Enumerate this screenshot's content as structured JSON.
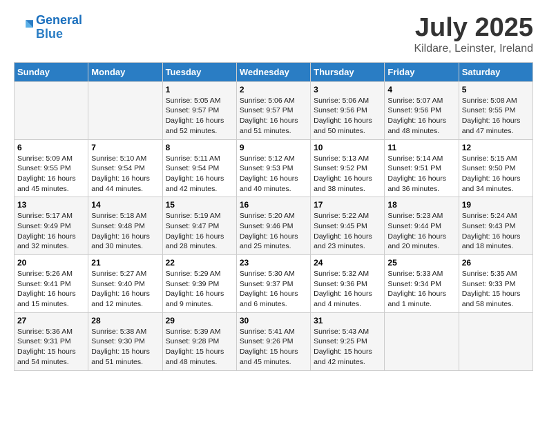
{
  "logo": {
    "line1": "General",
    "line2": "Blue"
  },
  "title": "July 2025",
  "subtitle": "Kildare, Leinster, Ireland",
  "days_of_week": [
    "Sunday",
    "Monday",
    "Tuesday",
    "Wednesday",
    "Thursday",
    "Friday",
    "Saturday"
  ],
  "weeks": [
    [
      {
        "day": "",
        "sunrise": "",
        "sunset": "",
        "daylight": ""
      },
      {
        "day": "",
        "sunrise": "",
        "sunset": "",
        "daylight": ""
      },
      {
        "day": "1",
        "sunrise": "Sunrise: 5:05 AM",
        "sunset": "Sunset: 9:57 PM",
        "daylight": "Daylight: 16 hours and 52 minutes."
      },
      {
        "day": "2",
        "sunrise": "Sunrise: 5:06 AM",
        "sunset": "Sunset: 9:57 PM",
        "daylight": "Daylight: 16 hours and 51 minutes."
      },
      {
        "day": "3",
        "sunrise": "Sunrise: 5:06 AM",
        "sunset": "Sunset: 9:56 PM",
        "daylight": "Daylight: 16 hours and 50 minutes."
      },
      {
        "day": "4",
        "sunrise": "Sunrise: 5:07 AM",
        "sunset": "Sunset: 9:56 PM",
        "daylight": "Daylight: 16 hours and 48 minutes."
      },
      {
        "day": "5",
        "sunrise": "Sunrise: 5:08 AM",
        "sunset": "Sunset: 9:55 PM",
        "daylight": "Daylight: 16 hours and 47 minutes."
      }
    ],
    [
      {
        "day": "6",
        "sunrise": "Sunrise: 5:09 AM",
        "sunset": "Sunset: 9:55 PM",
        "daylight": "Daylight: 16 hours and 45 minutes."
      },
      {
        "day": "7",
        "sunrise": "Sunrise: 5:10 AM",
        "sunset": "Sunset: 9:54 PM",
        "daylight": "Daylight: 16 hours and 44 minutes."
      },
      {
        "day": "8",
        "sunrise": "Sunrise: 5:11 AM",
        "sunset": "Sunset: 9:54 PM",
        "daylight": "Daylight: 16 hours and 42 minutes."
      },
      {
        "day": "9",
        "sunrise": "Sunrise: 5:12 AM",
        "sunset": "Sunset: 9:53 PM",
        "daylight": "Daylight: 16 hours and 40 minutes."
      },
      {
        "day": "10",
        "sunrise": "Sunrise: 5:13 AM",
        "sunset": "Sunset: 9:52 PM",
        "daylight": "Daylight: 16 hours and 38 minutes."
      },
      {
        "day": "11",
        "sunrise": "Sunrise: 5:14 AM",
        "sunset": "Sunset: 9:51 PM",
        "daylight": "Daylight: 16 hours and 36 minutes."
      },
      {
        "day": "12",
        "sunrise": "Sunrise: 5:15 AM",
        "sunset": "Sunset: 9:50 PM",
        "daylight": "Daylight: 16 hours and 34 minutes."
      }
    ],
    [
      {
        "day": "13",
        "sunrise": "Sunrise: 5:17 AM",
        "sunset": "Sunset: 9:49 PM",
        "daylight": "Daylight: 16 hours and 32 minutes."
      },
      {
        "day": "14",
        "sunrise": "Sunrise: 5:18 AM",
        "sunset": "Sunset: 9:48 PM",
        "daylight": "Daylight: 16 hours and 30 minutes."
      },
      {
        "day": "15",
        "sunrise": "Sunrise: 5:19 AM",
        "sunset": "Sunset: 9:47 PM",
        "daylight": "Daylight: 16 hours and 28 minutes."
      },
      {
        "day": "16",
        "sunrise": "Sunrise: 5:20 AM",
        "sunset": "Sunset: 9:46 PM",
        "daylight": "Daylight: 16 hours and 25 minutes."
      },
      {
        "day": "17",
        "sunrise": "Sunrise: 5:22 AM",
        "sunset": "Sunset: 9:45 PM",
        "daylight": "Daylight: 16 hours and 23 minutes."
      },
      {
        "day": "18",
        "sunrise": "Sunrise: 5:23 AM",
        "sunset": "Sunset: 9:44 PM",
        "daylight": "Daylight: 16 hours and 20 minutes."
      },
      {
        "day": "19",
        "sunrise": "Sunrise: 5:24 AM",
        "sunset": "Sunset: 9:43 PM",
        "daylight": "Daylight: 16 hours and 18 minutes."
      }
    ],
    [
      {
        "day": "20",
        "sunrise": "Sunrise: 5:26 AM",
        "sunset": "Sunset: 9:41 PM",
        "daylight": "Daylight: 16 hours and 15 minutes."
      },
      {
        "day": "21",
        "sunrise": "Sunrise: 5:27 AM",
        "sunset": "Sunset: 9:40 PM",
        "daylight": "Daylight: 16 hours and 12 minutes."
      },
      {
        "day": "22",
        "sunrise": "Sunrise: 5:29 AM",
        "sunset": "Sunset: 9:39 PM",
        "daylight": "Daylight: 16 hours and 9 minutes."
      },
      {
        "day": "23",
        "sunrise": "Sunrise: 5:30 AM",
        "sunset": "Sunset: 9:37 PM",
        "daylight": "Daylight: 16 hours and 6 minutes."
      },
      {
        "day": "24",
        "sunrise": "Sunrise: 5:32 AM",
        "sunset": "Sunset: 9:36 PM",
        "daylight": "Daylight: 16 hours and 4 minutes."
      },
      {
        "day": "25",
        "sunrise": "Sunrise: 5:33 AM",
        "sunset": "Sunset: 9:34 PM",
        "daylight": "Daylight: 16 hours and 1 minute."
      },
      {
        "day": "26",
        "sunrise": "Sunrise: 5:35 AM",
        "sunset": "Sunset: 9:33 PM",
        "daylight": "Daylight: 15 hours and 58 minutes."
      }
    ],
    [
      {
        "day": "27",
        "sunrise": "Sunrise: 5:36 AM",
        "sunset": "Sunset: 9:31 PM",
        "daylight": "Daylight: 15 hours and 54 minutes."
      },
      {
        "day": "28",
        "sunrise": "Sunrise: 5:38 AM",
        "sunset": "Sunset: 9:30 PM",
        "daylight": "Daylight: 15 hours and 51 minutes."
      },
      {
        "day": "29",
        "sunrise": "Sunrise: 5:39 AM",
        "sunset": "Sunset: 9:28 PM",
        "daylight": "Daylight: 15 hours and 48 minutes."
      },
      {
        "day": "30",
        "sunrise": "Sunrise: 5:41 AM",
        "sunset": "Sunset: 9:26 PM",
        "daylight": "Daylight: 15 hours and 45 minutes."
      },
      {
        "day": "31",
        "sunrise": "Sunrise: 5:43 AM",
        "sunset": "Sunset: 9:25 PM",
        "daylight": "Daylight: 15 hours and 42 minutes."
      },
      {
        "day": "",
        "sunrise": "",
        "sunset": "",
        "daylight": ""
      },
      {
        "day": "",
        "sunrise": "",
        "sunset": "",
        "daylight": ""
      }
    ]
  ]
}
